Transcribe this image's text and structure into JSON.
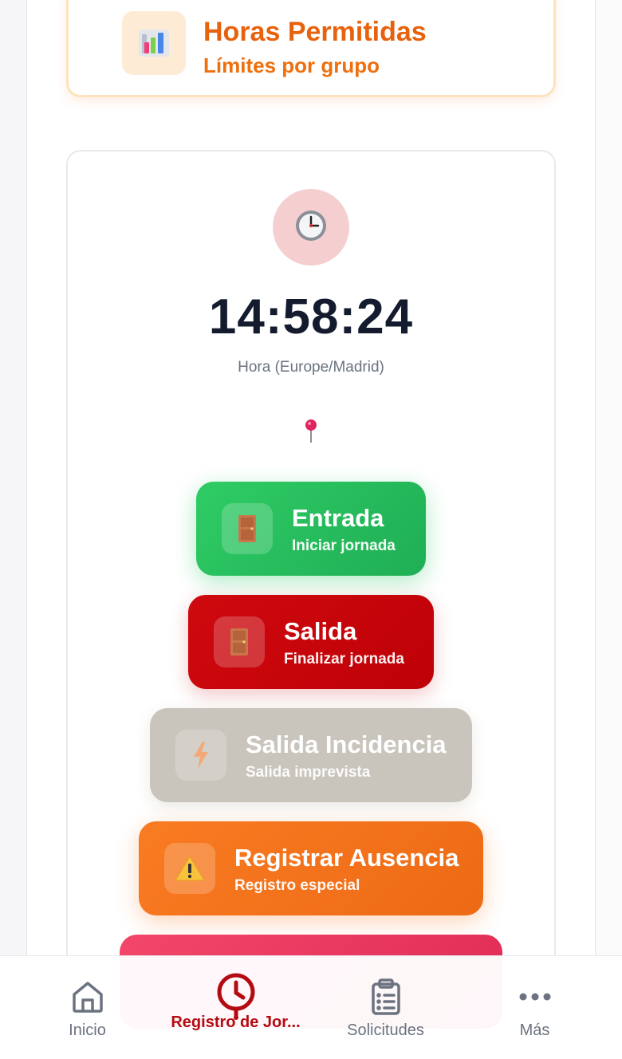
{
  "top_card": {
    "title": "Horas Permitidas",
    "subtitle": "Límites por grupo",
    "icon": "bar-chart-icon"
  },
  "clock": {
    "icon": "clock-icon",
    "time": "14:58:24",
    "timezone_label": "Hora (Europe/Madrid)",
    "location_icon": "pushpin-icon"
  },
  "actions": [
    {
      "title": "Entrada",
      "subtitle": "Iniciar jornada",
      "icon": "door-icon",
      "color": "#22c55e"
    },
    {
      "title": "Salida",
      "subtitle": "Finalizar jornada",
      "icon": "door-icon",
      "color": "#c8000a"
    },
    {
      "title": "Salida Incidencia",
      "subtitle": "Salida imprevista",
      "icon": "lightning-icon",
      "color": "#c6c1b7"
    },
    {
      "title": "Registrar Ausencia",
      "subtitle": "Registro especial",
      "icon": "warning-icon",
      "color": "#f97316"
    }
  ],
  "bottom_nav": {
    "items": [
      {
        "label": "Inicio",
        "icon": "home-icon"
      },
      {
        "label": "Registro de Jor...",
        "icon": "clock-icon",
        "active": true
      },
      {
        "label": "Solicitudes",
        "icon": "clipboard-icon"
      },
      {
        "label": "Más",
        "icon": "more-dots-icon"
      }
    ],
    "active_color": "#b40b12"
  }
}
